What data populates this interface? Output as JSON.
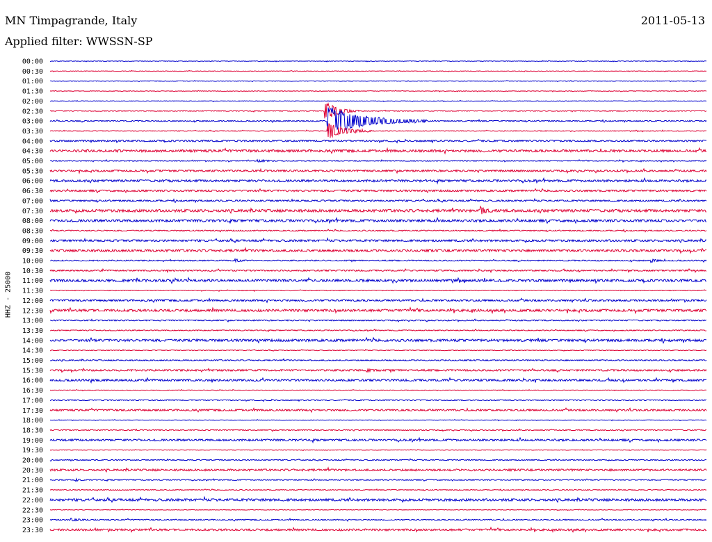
{
  "header": {
    "station": "MN Timpagrande, Italy",
    "date": "2011-05-13",
    "filter": "Applied filter: WWSSN-SP"
  },
  "chart_data": {
    "type": "line",
    "title": "MN Timpagrande, Italy",
    "subtitle": "Applied filter: WWSSN-SP",
    "ylabel": "HHZ - 25000",
    "colors": {
      "odd_row": "#0000cc",
      "even_row": "#dd0033"
    },
    "rows": [
      "00:00",
      "00:30",
      "01:00",
      "01:30",
      "02:00",
      "02:30",
      "03:00",
      "03:30",
      "04:00",
      "04:30",
      "05:00",
      "05:30",
      "06:00",
      "06:30",
      "07:00",
      "07:30",
      "08:00",
      "08:30",
      "09:00",
      "09:30",
      "10:00",
      "10:30",
      "11:00",
      "11:30",
      "12:00",
      "12:30",
      "13:00",
      "13:30",
      "14:00",
      "14:30",
      "15:00",
      "15:30",
      "16:00",
      "16:30",
      "17:00",
      "17:30",
      "18:00",
      "18:30",
      "19:00",
      "19:30",
      "20:00",
      "20:30",
      "21:00",
      "21:30",
      "22:00",
      "22:30",
      "23:00",
      "23:30"
    ],
    "row_noise": [
      0.3,
      0.3,
      0.3,
      0.3,
      0.3,
      0.4,
      0.6,
      0.4,
      0.8,
      1.2,
      0.5,
      0.9,
      1.1,
      0.9,
      0.8,
      1.3,
      1.2,
      0.6,
      1.0,
      1.1,
      0.6,
      0.7,
      1.2,
      0.4,
      0.9,
      1.2,
      0.6,
      0.5,
      1.2,
      0.4,
      0.6,
      0.9,
      1.0,
      0.3,
      0.5,
      0.9,
      0.3,
      0.5,
      1.0,
      0.3,
      0.5,
      1.0,
      0.5,
      0.4,
      1.2,
      0.3,
      0.6,
      1.0
    ],
    "events": [
      {
        "row": "02:30",
        "minute": 12.6,
        "amplitude": 14,
        "duration": 1.5
      },
      {
        "row": "03:00",
        "minute": 12.7,
        "amplitude": 22,
        "duration": 4.5
      },
      {
        "row": "03:30",
        "minute": 12.7,
        "amplitude": 12,
        "duration": 2.0
      },
      {
        "row": "07:30",
        "minute": 19.7,
        "amplitude": 5,
        "duration": 0.6
      },
      {
        "row": "10:00",
        "minute": 8.5,
        "amplitude": 2,
        "duration": 0.7
      },
      {
        "row": "10:00",
        "minute": 27.5,
        "amplitude": 2,
        "duration": 0.7
      },
      {
        "row": "05:00",
        "minute": 9.5,
        "amplitude": 1.5,
        "duration": 1.2
      },
      {
        "row": "23:00",
        "minute": 1.0,
        "amplitude": 1.5,
        "duration": 1.3
      },
      {
        "row": "21:00",
        "minute": 1.2,
        "amplitude": 1.5,
        "duration": 0.4
      },
      {
        "row": "15:30",
        "minute": 14.5,
        "amplitude": 1.5,
        "duration": 0.6
      }
    ]
  }
}
